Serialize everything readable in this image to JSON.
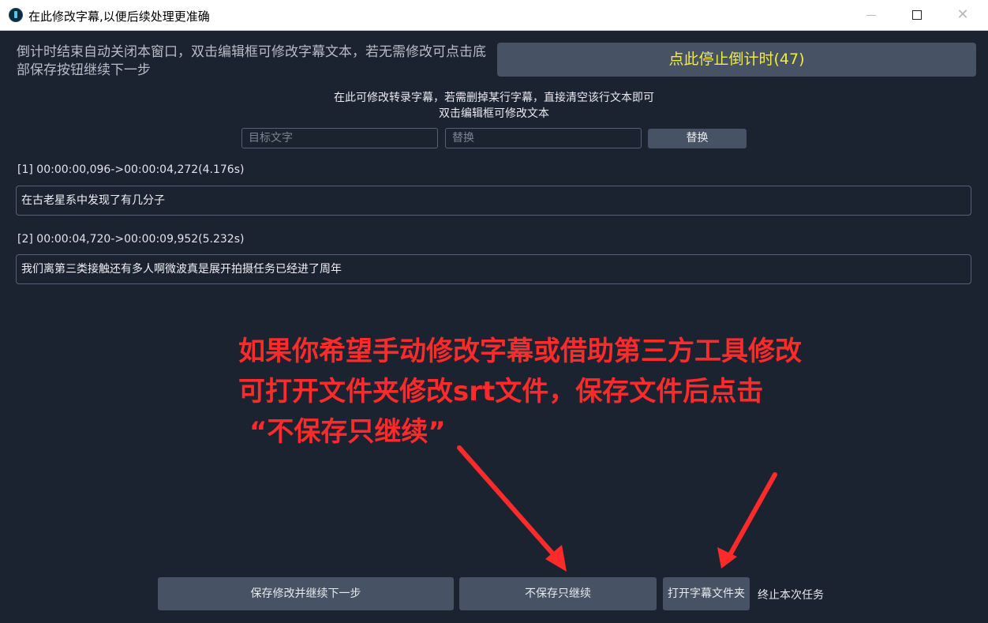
{
  "window": {
    "title": "在此修改字幕,以便后续处理更准确",
    "close_glyph": "✕"
  },
  "header": {
    "countdown_info": "倒计时结束自动关闭本窗口，双击编辑框可修改字幕文本，若无需修改可点击底部保存按钮继续下一步",
    "stop_countdown_label": "点此停止倒计时(47)"
  },
  "hints": {
    "line1": "在此可修改转录字幕，若需删掉某行字幕，直接清空该行文本即可",
    "line2": "双击编辑框可修改文本"
  },
  "search": {
    "target_placeholder": "目标文字",
    "target_value": "",
    "replace_placeholder": "替换",
    "replace_value": "",
    "replace_button": "替换"
  },
  "subtitles": [
    {
      "timestamp": "[1] 00:00:00,096->00:00:04,272(4.176s)",
      "text": "在古老星系中发现了有几分子"
    },
    {
      "timestamp": "[2] 00:00:04,720->00:00:09,952(5.232s)",
      "text": "我们离第三类接触还有多人啊微波真是展开拍摄任务已经进了周年"
    }
  ],
  "annotation": {
    "line1": "如果你希望手动修改字幕或借助第三方工具修改",
    "line2": "可打开文件夹修改srt文件，保存文件后点击",
    "line3": "“不保存只继续”",
    "color": "#ff2b2b"
  },
  "footer": {
    "save_continue": "保存修改并继续下一步",
    "continue_without_save": "不保存只继续",
    "open_folder": "打开字幕文件夹",
    "terminate": "终止本次任务"
  },
  "colors": {
    "background": "#1b2230",
    "button": "#475364",
    "countdown_text": "#f1ec3e"
  }
}
